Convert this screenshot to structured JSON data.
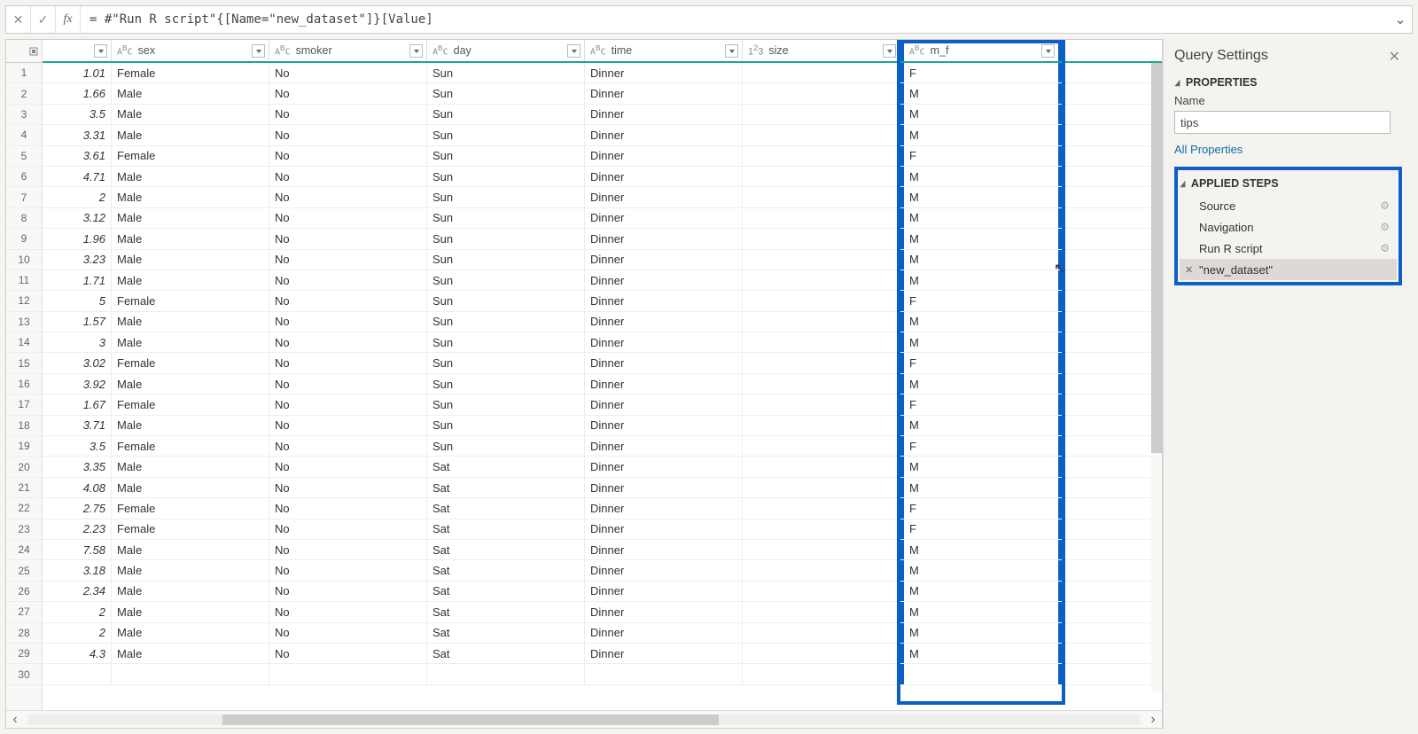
{
  "formula_bar": {
    "fx_label": "fx",
    "formula": "= #\"Run R script\"{[Name=\"new_dataset\"]}[Value]"
  },
  "columns": [
    {
      "label": "",
      "type": "",
      "width": "w1"
    },
    {
      "label": "sex",
      "type": "ABC",
      "width": "w2"
    },
    {
      "label": "smoker",
      "type": "ABC",
      "width": "w3"
    },
    {
      "label": "day",
      "type": "ABC",
      "width": "w4"
    },
    {
      "label": "time",
      "type": "ABC",
      "width": "w5"
    },
    {
      "label": "size",
      "type": "123",
      "width": "w6"
    },
    {
      "label": "m_f",
      "type": "ABC",
      "width": "w7",
      "highlight": true
    }
  ],
  "rows": [
    {
      "n": "1",
      "c0": "1.01",
      "sex": "Female",
      "smoker": "No",
      "day": "Sun",
      "time": "Dinner",
      "size": "",
      "mf": "F"
    },
    {
      "n": "2",
      "c0": "1.66",
      "sex": "Male",
      "smoker": "No",
      "day": "Sun",
      "time": "Dinner",
      "size": "",
      "mf": "M"
    },
    {
      "n": "3",
      "c0": "3.5",
      "sex": "Male",
      "smoker": "No",
      "day": "Sun",
      "time": "Dinner",
      "size": "",
      "mf": "M"
    },
    {
      "n": "4",
      "c0": "3.31",
      "sex": "Male",
      "smoker": "No",
      "day": "Sun",
      "time": "Dinner",
      "size": "",
      "mf": "M"
    },
    {
      "n": "5",
      "c0": "3.61",
      "sex": "Female",
      "smoker": "No",
      "day": "Sun",
      "time": "Dinner",
      "size": "",
      "mf": "F"
    },
    {
      "n": "6",
      "c0": "4.71",
      "sex": "Male",
      "smoker": "No",
      "day": "Sun",
      "time": "Dinner",
      "size": "",
      "mf": "M"
    },
    {
      "n": "7",
      "c0": "2",
      "sex": "Male",
      "smoker": "No",
      "day": "Sun",
      "time": "Dinner",
      "size": "",
      "mf": "M"
    },
    {
      "n": "8",
      "c0": "3.12",
      "sex": "Male",
      "smoker": "No",
      "day": "Sun",
      "time": "Dinner",
      "size": "",
      "mf": "M"
    },
    {
      "n": "9",
      "c0": "1.96",
      "sex": "Male",
      "smoker": "No",
      "day": "Sun",
      "time": "Dinner",
      "size": "",
      "mf": "M"
    },
    {
      "n": "10",
      "c0": "3.23",
      "sex": "Male",
      "smoker": "No",
      "day": "Sun",
      "time": "Dinner",
      "size": "",
      "mf": "M"
    },
    {
      "n": "11",
      "c0": "1.71",
      "sex": "Male",
      "smoker": "No",
      "day": "Sun",
      "time": "Dinner",
      "size": "",
      "mf": "M"
    },
    {
      "n": "12",
      "c0": "5",
      "sex": "Female",
      "smoker": "No",
      "day": "Sun",
      "time": "Dinner",
      "size": "",
      "mf": "F"
    },
    {
      "n": "13",
      "c0": "1.57",
      "sex": "Male",
      "smoker": "No",
      "day": "Sun",
      "time": "Dinner",
      "size": "",
      "mf": "M"
    },
    {
      "n": "14",
      "c0": "3",
      "sex": "Male",
      "smoker": "No",
      "day": "Sun",
      "time": "Dinner",
      "size": "",
      "mf": "M"
    },
    {
      "n": "15",
      "c0": "3.02",
      "sex": "Female",
      "smoker": "No",
      "day": "Sun",
      "time": "Dinner",
      "size": "",
      "mf": "F"
    },
    {
      "n": "16",
      "c0": "3.92",
      "sex": "Male",
      "smoker": "No",
      "day": "Sun",
      "time": "Dinner",
      "size": "",
      "mf": "M"
    },
    {
      "n": "17",
      "c0": "1.67",
      "sex": "Female",
      "smoker": "No",
      "day": "Sun",
      "time": "Dinner",
      "size": "",
      "mf": "F"
    },
    {
      "n": "18",
      "c0": "3.71",
      "sex": "Male",
      "smoker": "No",
      "day": "Sun",
      "time": "Dinner",
      "size": "",
      "mf": "M"
    },
    {
      "n": "19",
      "c0": "3.5",
      "sex": "Female",
      "smoker": "No",
      "day": "Sun",
      "time": "Dinner",
      "size": "",
      "mf": "F"
    },
    {
      "n": "20",
      "c0": "3.35",
      "sex": "Male",
      "smoker": "No",
      "day": "Sat",
      "time": "Dinner",
      "size": "",
      "mf": "M"
    },
    {
      "n": "21",
      "c0": "4.08",
      "sex": "Male",
      "smoker": "No",
      "day": "Sat",
      "time": "Dinner",
      "size": "",
      "mf": "M"
    },
    {
      "n": "22",
      "c0": "2.75",
      "sex": "Female",
      "smoker": "No",
      "day": "Sat",
      "time": "Dinner",
      "size": "",
      "mf": "F"
    },
    {
      "n": "23",
      "c0": "2.23",
      "sex": "Female",
      "smoker": "No",
      "day": "Sat",
      "time": "Dinner",
      "size": "",
      "mf": "F"
    },
    {
      "n": "24",
      "c0": "7.58",
      "sex": "Male",
      "smoker": "No",
      "day": "Sat",
      "time": "Dinner",
      "size": "",
      "mf": "M"
    },
    {
      "n": "25",
      "c0": "3.18",
      "sex": "Male",
      "smoker": "No",
      "day": "Sat",
      "time": "Dinner",
      "size": "",
      "mf": "M"
    },
    {
      "n": "26",
      "c0": "2.34",
      "sex": "Male",
      "smoker": "No",
      "day": "Sat",
      "time": "Dinner",
      "size": "",
      "mf": "M"
    },
    {
      "n": "27",
      "c0": "2",
      "sex": "Male",
      "smoker": "No",
      "day": "Sat",
      "time": "Dinner",
      "size": "",
      "mf": "M"
    },
    {
      "n": "28",
      "c0": "2",
      "sex": "Male",
      "smoker": "No",
      "day": "Sat",
      "time": "Dinner",
      "size": "",
      "mf": "M"
    },
    {
      "n": "29",
      "c0": "4.3",
      "sex": "Male",
      "smoker": "No",
      "day": "Sat",
      "time": "Dinner",
      "size": "",
      "mf": "M"
    },
    {
      "n": "30",
      "c0": "",
      "sex": "",
      "smoker": "",
      "day": "",
      "time": "",
      "size": "",
      "mf": ""
    }
  ],
  "panel": {
    "title": "Query Settings",
    "properties_header": "PROPERTIES",
    "name_label": "Name",
    "name_value": "tips",
    "all_props_link": "All Properties",
    "applied_header": "APPLIED STEPS",
    "steps": [
      {
        "label": "Source",
        "gear": true
      },
      {
        "label": "Navigation",
        "gear": true
      },
      {
        "label": "Run R script",
        "gear": true
      },
      {
        "label": "\"new_dataset\"",
        "selected": true
      }
    ]
  }
}
